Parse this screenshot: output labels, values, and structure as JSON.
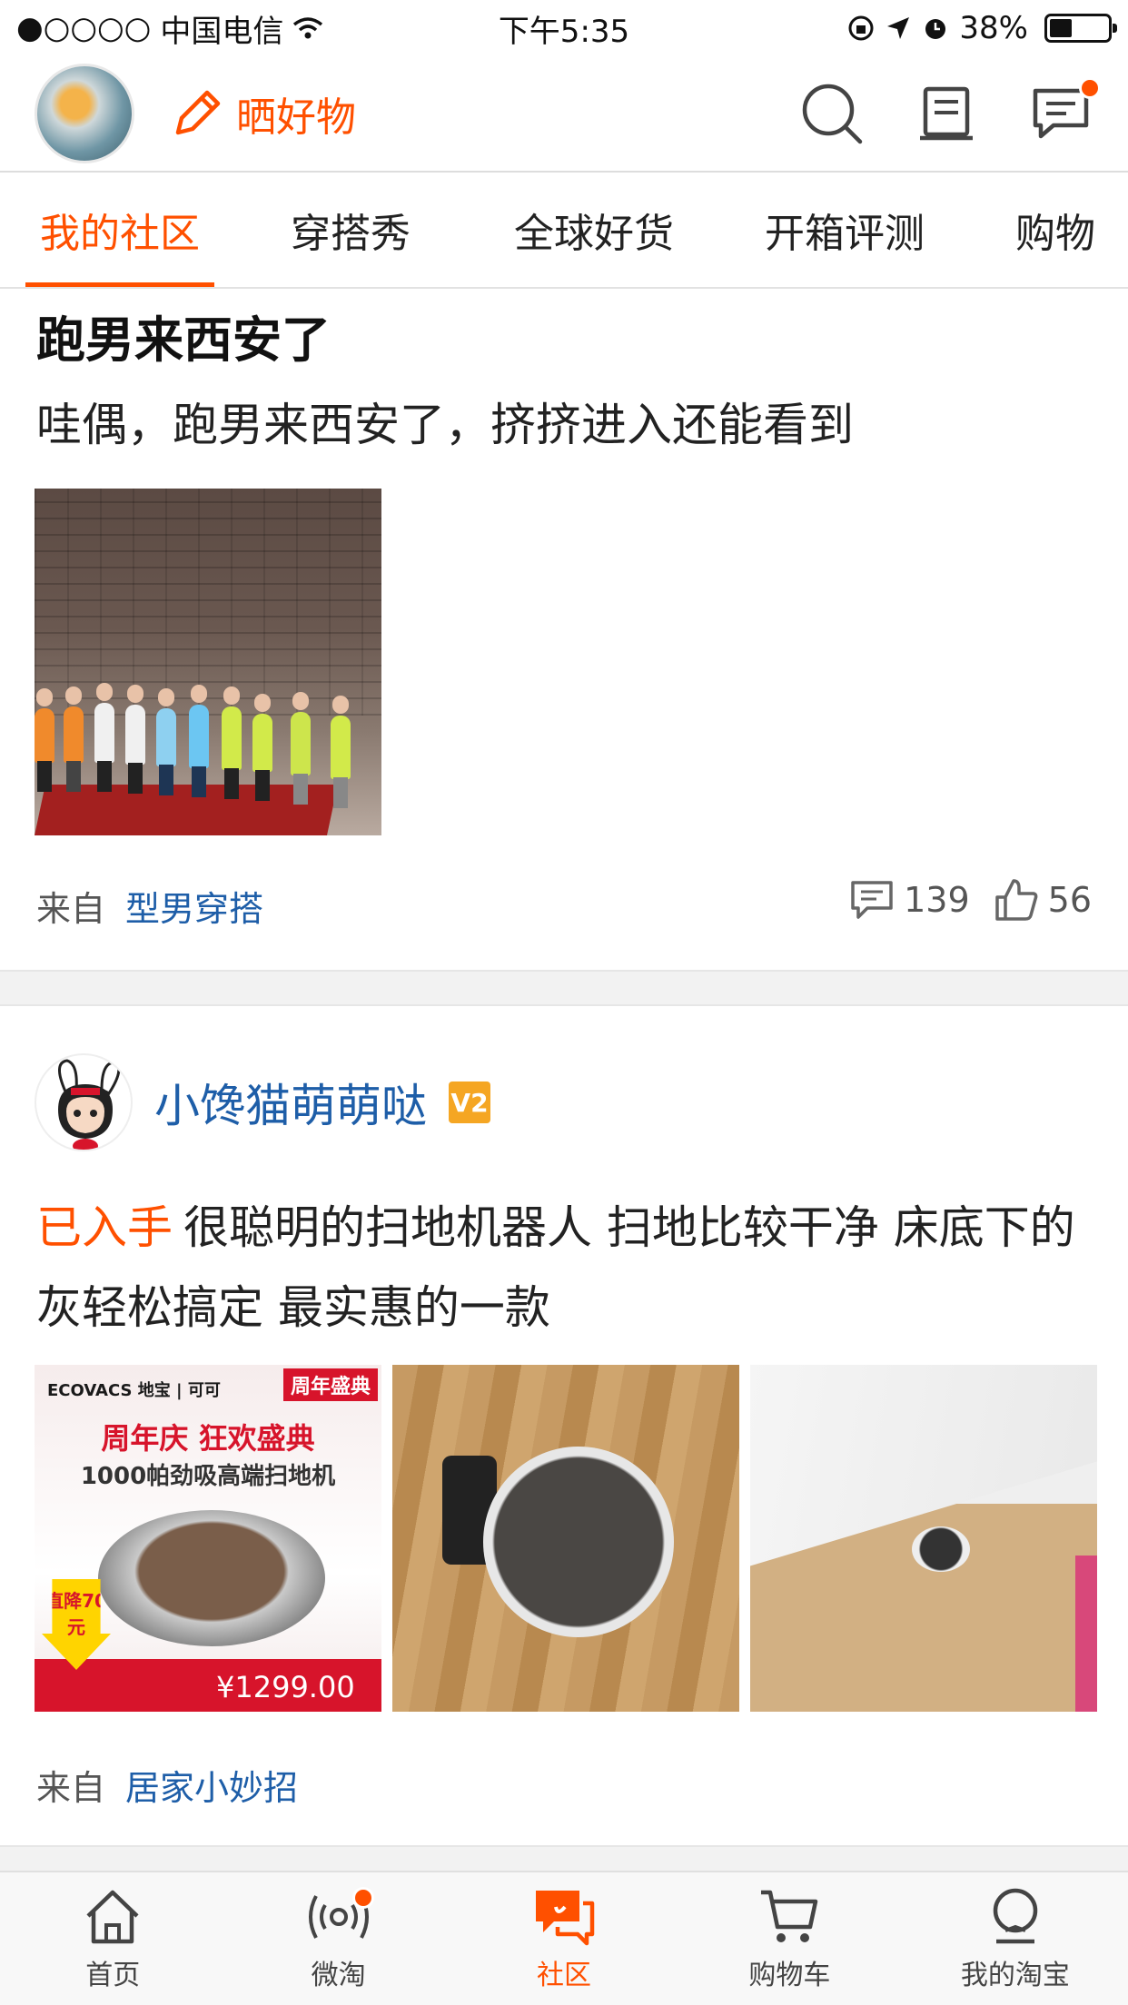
{
  "status_bar": {
    "carrier": "中国电信",
    "time": "下午5:35",
    "battery": "38%"
  },
  "header": {
    "post_label": "晒好物",
    "icons": [
      "search-icon",
      "notepad-icon",
      "message-icon"
    ],
    "accent_color": "#ff5000"
  },
  "tabs": [
    {
      "label": "我的社区",
      "active": true
    },
    {
      "label": "穿搭秀",
      "active": false
    },
    {
      "label": "全球好货",
      "active": false
    },
    {
      "label": "开箱评测",
      "active": false
    },
    {
      "label": "购物",
      "active": false
    }
  ],
  "post1": {
    "title": "跑男来西安了",
    "body": "哇偶，跑男来西安了，挤挤进入还能看到",
    "from_label": "来自",
    "source": "型男穿搭",
    "comments": "139",
    "likes": "56"
  },
  "post2": {
    "username": "小馋猫萌萌哒",
    "badge": "V2",
    "tag": "已入手",
    "text": "很聪明的扫地机器人 扫地比较干净 床底下的灰轻松搞定 最实惠的一款",
    "from_label": "来自",
    "source": "居家小妙招",
    "thumb1": {
      "brand": "ECOVACS 地宝 | 可可",
      "annivers": "周年盛典",
      "headline": "周年庆 狂欢盛典",
      "subline": "1000帕劲吸高端扫地机",
      "discount": "直降70元",
      "price": "¥1299.00"
    }
  },
  "bottom_nav": [
    {
      "label": "首页",
      "icon": "home-icon",
      "active": false
    },
    {
      "label": "微淘",
      "icon": "broadcast-icon",
      "active": false
    },
    {
      "label": "社区",
      "icon": "community-icon",
      "active": true
    },
    {
      "label": "购物车",
      "icon": "cart-icon",
      "active": false
    },
    {
      "label": "我的淘宝",
      "icon": "profile-icon",
      "active": false
    }
  ]
}
